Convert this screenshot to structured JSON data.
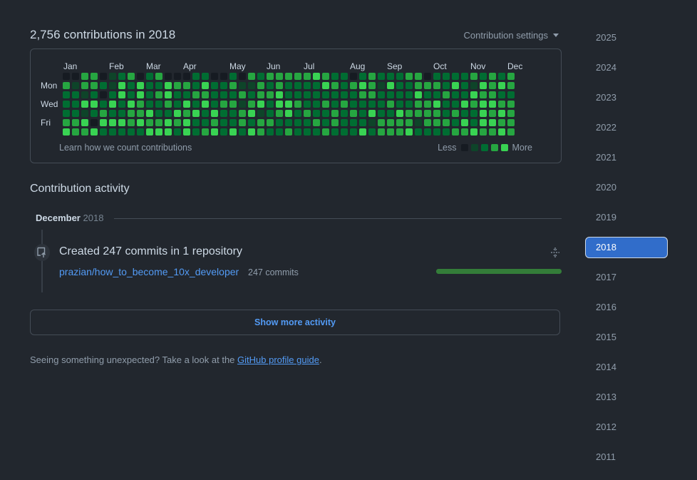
{
  "contrib": {
    "title": "2,756 contributions in 2018",
    "settings_label": "Contribution settings",
    "months": [
      "Jan",
      "Feb",
      "Mar",
      "Apr",
      "May",
      "Jun",
      "Jul",
      "Aug",
      "Sep",
      "Oct",
      "Nov",
      "Dec"
    ],
    "day_labels": [
      "Mon",
      "Wed",
      "Fri"
    ],
    "footnote": "Learn how we count contributions",
    "legend_less": "Less",
    "legend_more": "More",
    "colors": [
      "#161b22",
      "#0e4429",
      "#006d32",
      "#26a641",
      "#39d353"
    ],
    "levels": [
      "0033012302300022002032333334322023222330222232323",
      "3133214242243324223113232222432343142233324214343",
      "2212024242342233222323342222222233222242232243322",
      "2244242432232424233134244322323222232233422434433",
      "2212322334224342422341234232232324224333323224343",
      "3340444343343422322323322223232221333313332424433",
      "4334222224442423424243223222322242333422223343343"
    ]
  },
  "activity": {
    "title": "Contribution activity",
    "month": "December",
    "year": "2018",
    "event_title": "Created 247 commits in 1 repository",
    "repo": "prazian/how_to_become_10x_developer",
    "repo_count": "247 commits",
    "progress_fraction": 1.0
  },
  "show_more": "Show more activity",
  "unexpected": {
    "text": "Seeing something unexpected? Take a look at the",
    "link": "GitHub profile guide",
    "end": "."
  },
  "years": [
    "2025",
    "2024",
    "2023",
    "2022",
    "2021",
    "2020",
    "2019",
    "2018",
    "2017",
    "2016",
    "2015",
    "2014",
    "2013",
    "2012",
    "2011"
  ],
  "selected_year": "2018"
}
